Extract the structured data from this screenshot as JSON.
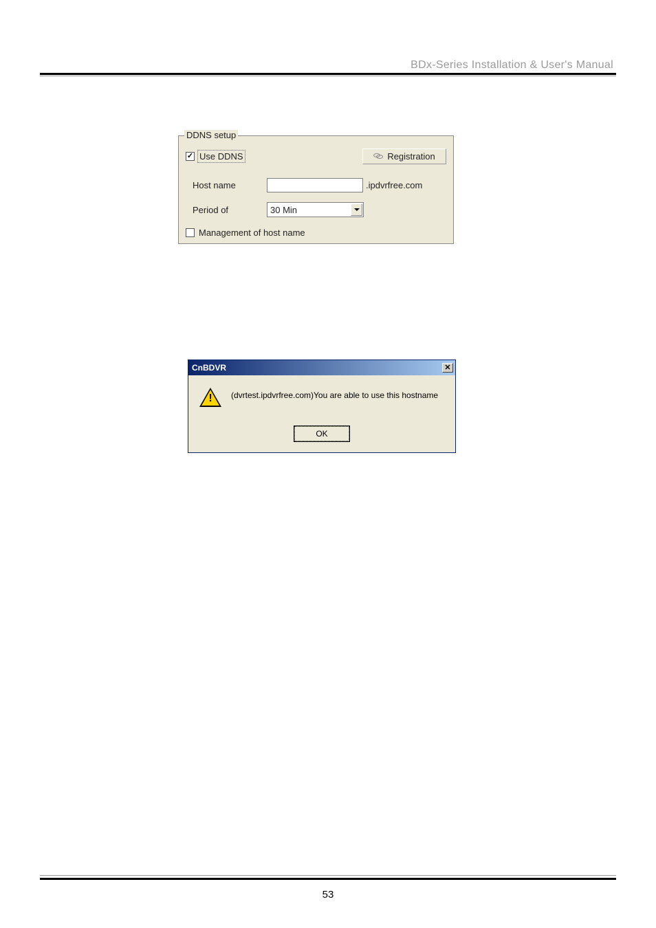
{
  "header": {
    "title": "BDx-Series Installation & User's Manual"
  },
  "ddns": {
    "legend": "DDNS setup",
    "use_ddns_label": "Use DDNS",
    "use_ddns_checked": true,
    "registration_label": "Registration",
    "host_name_label": "Host name",
    "host_name_value": "",
    "host_suffix": ".ipdvrfree.com",
    "period_label": "Period of",
    "period_value": "30 Min",
    "management_label": "Management of host name",
    "management_checked": false
  },
  "dialog": {
    "title": "CnBDVR",
    "message": "(dvrtest.ipdvrfree.com)You are able to use this hostname",
    "ok_label": "OK"
  },
  "footer": {
    "page_number": "53"
  }
}
